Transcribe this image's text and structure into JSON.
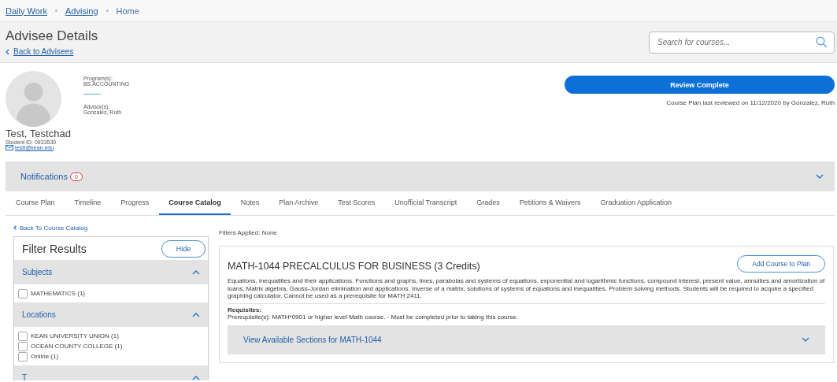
{
  "breadcrumb": [
    {
      "label": "Daily Work",
      "kind": "link"
    },
    {
      "label": "Advising",
      "kind": "link"
    },
    {
      "label": "Home",
      "kind": "current"
    }
  ],
  "page": {
    "title": "Advisee Details",
    "back_link": "Back to Advisees"
  },
  "search": {
    "placeholder": "Search for courses..."
  },
  "student": {
    "name": "Test, Testchad",
    "student_id": "Student ID: 0933530",
    "email": "testt@kean.edu",
    "programs_label": "Program(s):",
    "program": "BS.ACCOUNTING",
    "advisors_label": "Advisor(s):",
    "advisor": "Gonzalez, Ruth"
  },
  "review": {
    "button": "Review Complete",
    "note": "Course Plan last reviewed on 11/12/2020 by Gonzalez, Ruth"
  },
  "notifications": {
    "label": "Notifications",
    "count": "0",
    "expanded": false
  },
  "tabs": [
    {
      "label": "Course Plan",
      "selected": false
    },
    {
      "label": "Timeline",
      "selected": false
    },
    {
      "label": "Progress",
      "selected": false
    },
    {
      "label": "Course Catalog",
      "selected": true
    },
    {
      "label": "Notes",
      "selected": false
    },
    {
      "label": "Plan Archive",
      "selected": false
    },
    {
      "label": "Test Scores",
      "selected": false
    },
    {
      "label": "Unofficial Transcript",
      "selected": false
    },
    {
      "label": "Grades",
      "selected": false
    },
    {
      "label": "Petitions & Waivers",
      "selected": false
    },
    {
      "label": "Graduation Application",
      "selected": false
    }
  ],
  "filters": {
    "back_link": "Back To Course Catalog",
    "title": "Filter Results",
    "hide_button": "Hide",
    "sections": [
      {
        "title": "Subjects",
        "expanded": true,
        "options": [
          {
            "label": "MATHEMATICS (1)",
            "checked": false
          }
        ]
      },
      {
        "title": "Locations",
        "expanded": true,
        "options": [
          {
            "label": "KEAN UNIVERSITY UNION (1)",
            "checked": false
          },
          {
            "label": "OCEAN COUNTY COLLEGE (1)",
            "checked": false
          },
          {
            "label": "Online (1)",
            "checked": false
          }
        ]
      },
      {
        "title": "T",
        "expanded": true
      }
    ]
  },
  "filters_applied": "Filters Applied: None",
  "course": {
    "title": "MATH-1044 PRECALCULUS FOR BUSINESS (3 Credits)",
    "add_button": "Add Course to Plan",
    "description": "Equations, inequalities and their applications. Functions and graphs, lines, parabolas and systems of equations, exponential and logarithmic functions, compound interest, present value, annuities and amortization of loans. Matrix algebra, Gauss-Jordan elimination and applications. Inverse of a matrix, solutions of systems of equations and inequalities. Problem solving methods. Students will be required to acquire a specified graphing calculator. Cannot be used as a prerequisite for MATH 2411.",
    "requisites_label": "Requisites:",
    "requisites": "Prerequisite(s): MATH*0901 or higher level Math course. - Must be completed prior to taking this course.",
    "sections_link": "View Available Sections for MATH-1044",
    "sections_expanded": false
  }
}
